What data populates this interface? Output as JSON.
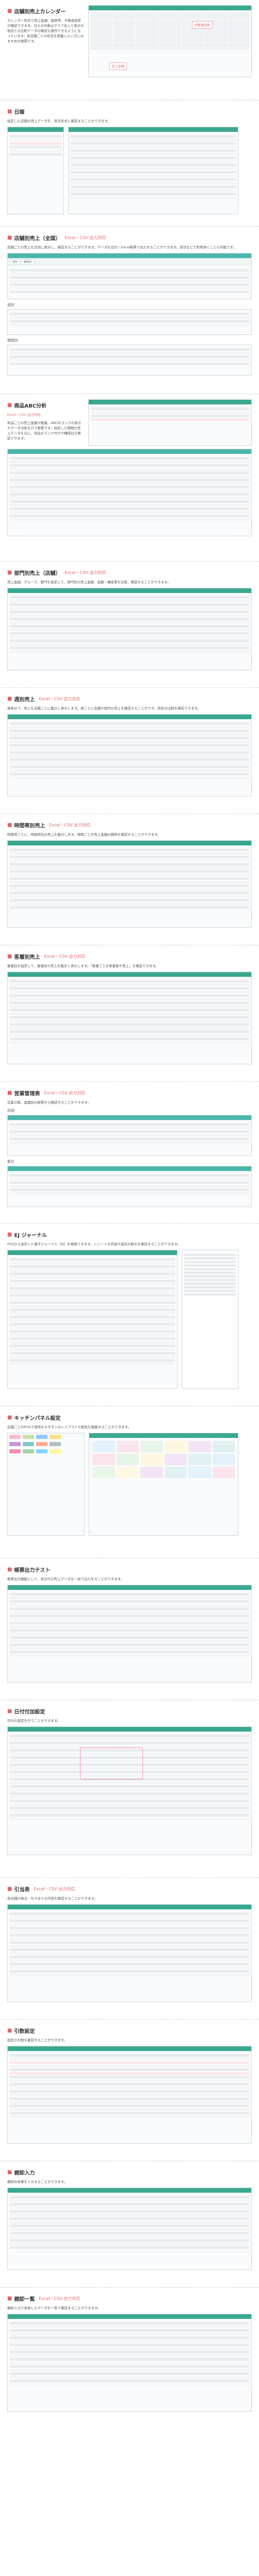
{
  "sections": [
    {
      "title": "店舗別売上カレンダー",
      "desc": "カレンダー形式で売上金額、客数等、予算達成率が確認できます。日々の計数はグラフ化して表示や他店との比較データの確認も操作できるようになっています。各店舗ごとの状況を把握したい方におすすめの帳票です。"
    },
    {
      "title": "日報",
      "desc": "指定した店舗の売上データを、表示形式に確認することができます。"
    },
    {
      "title": "店舗別売上（全国）",
      "badge": "Excel・CSV 出力対応",
      "desc": "店舗ごとの売上を日別に表示し、確認することができます。データを日付・Excel帳票で出力することができます。前日などで利用頂くことも可能です。"
    },
    {
      "title": "商品ABC分析",
      "badge": "Excel・CSV 出力対応",
      "desc": "商品ごとの売上金額や数量、ABCのランクの表示やデータ分析を行う帳票です。指定した期間の売上データを元に、商品のランク付けや構成比を確認できます。"
    },
    {
      "title": "部門別売上（店舗）",
      "badge": "Excel・CSV 出力対応",
      "desc": "売上金額、グループ、部門を指定して、部門別の売上金額、金額・構成率を比較、確認することができます。"
    },
    {
      "title": "週別売上",
      "badge": "Excel・CSV 出力対応",
      "desc": "週単位で、売上を店舗ごとに集計し表示します。週ごとに店舗や部門の売上を確認することができ、前年の比較を確認できます。"
    },
    {
      "title": "時間帯別売上",
      "badge": "Excel・CSV 出力対応",
      "desc": "時間帯ごとに、時間帯別の売上を集計します。時間ごとの売上金額の推移を確認することができます。"
    },
    {
      "title": "客層別売上",
      "badge": "Excel・CSV 出力対応",
      "desc": "客層別を指定して、客層別の売上を集計し表示します。「客層ごとの来客数や売上」を確認できます。"
    },
    {
      "title": "営業管理表",
      "badge": "Excel・CSV 出力対応",
      "desc": "営業の数、金額別の帳票から確認することができます。"
    },
    {
      "title": "EJ ジャーナル",
      "desc": "POSから送信した電子ジャーナル（EJ）を検索できます。レシートの内容や過去の取引を確認することができます。"
    },
    {
      "title": "キッチンパネル設定",
      "desc": "店舗ごとのPOSで使用するボタンのレイアウトや配色を編集することができます。"
    },
    {
      "title": "帳票出力テスト",
      "desc": "帳票出力機能として、各日付の売上データを一括で出力することができます。"
    },
    {
      "title": "日付付加設定",
      "desc": "日付の設定を行うことができます。"
    },
    {
      "title": "引当表",
      "badge": "Excel・CSV 出力対応",
      "desc": "各店舗の発注・引き当ての内容を確認することができます。"
    },
    {
      "title": "引数設定",
      "desc": "設定の引数を確認することができます。"
    },
    {
      "title": "棚卸入力",
      "desc": "棚卸の結果を入力することができます。"
    },
    {
      "title": "棚卸一覧",
      "badge": "Excel・CSV 出力対応",
      "desc": "棚卸入力で登録したデータを一覧で確認することができます。"
    }
  ],
  "captions": {
    "weekly": "週別",
    "period": "期間別",
    "detail": "詳細",
    "summary": "集計"
  },
  "callouts": {
    "sales_calendar": "売上金額",
    "budget": "予算達成率"
  }
}
